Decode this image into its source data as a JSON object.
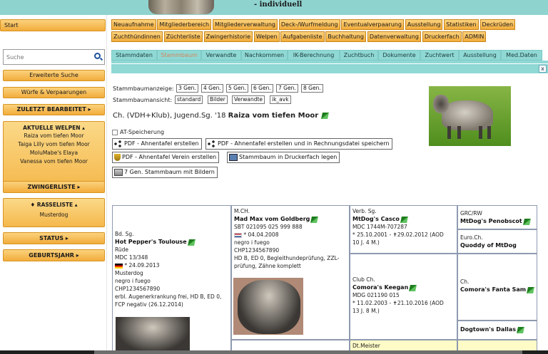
{
  "header": {
    "subtitle": "- individuell"
  },
  "sidebar": {
    "start": "Start",
    "search_placeholder": "Suche",
    "buttons": [
      "Erweiterte Suche",
      "Würfe & Verpaarungen",
      "ZULETZT BEARBEITET ▸"
    ],
    "current_welpen": {
      "title": "AKTUELLE WELPEN ▴",
      "items": [
        "Raiza vom tiefen Moor",
        "Taiga Lilly vom tiefen Moor",
        "MoluMabe's Elaya",
        "Vanessa vom tiefen Moor"
      ]
    },
    "zwingerliste": "ZWINGERLISTE ▸",
    "rasseliste": {
      "title": "♦ RASSELISTE ▴",
      "items": [
        "Musterdog"
      ]
    },
    "status": "STATUS ▸",
    "geburtsjahr": "GEBURTSJAHR ▸"
  },
  "menu_row1": [
    "Neuaufnahme",
    "Mitgliederbereich",
    "Mitgliederverwaltung",
    "Deck-/Wurfmeldung",
    "Eventualverpaarung",
    "Ausstellung",
    "Statistiken",
    "Deckrüden"
  ],
  "menu_row2": [
    "Zuchthündinnen",
    "Züchterliste",
    "Zwingerhistorie",
    "Welpen",
    "Aufgabenliste",
    "Buchhaltung",
    "Datenverwaltung",
    "Druckerfach",
    "ADMIN"
  ],
  "tabs": [
    "Stammdaten",
    "Stammbaum",
    "Verwandte",
    "Nachkommen",
    "IK-Berechnung",
    "Zuchtbuch",
    "Dokumente",
    "Zuchtwert",
    "Ausstellung",
    "Med.Daten"
  ],
  "close_label": "x",
  "stammbaum": {
    "anzeige_label": "Stammbaumanzeige:",
    "generations": [
      "3 Gen.",
      "4 Gen.",
      "5 Gen.",
      "6 Gen.",
      "7 Gen.",
      "8 Gen."
    ],
    "ansicht_label": "Stammbaumansicht:",
    "views": [
      "standard",
      "Bilder",
      "Verwandte",
      "ik_avk"
    ],
    "dog_prefix": "Ch. (VDH+Klub), Jugend.Sg. '18",
    "dog_name": "Raiza vom tiefen Moor",
    "at_speicherung": "AT-Speicherung",
    "actions": [
      "PDF - Ahnentafel erstellen",
      "PDF - Ahnentafel erstellen und in Rechnungsdatei speichern",
      "PDF - Ahnentafel Verein erstellen",
      "Stammbaum in Druckerfach legen",
      "7 Gen. Stammbaum mit Bildern"
    ]
  },
  "pedigree": {
    "father": {
      "title": "Bd. Sg.",
      "name": "Hot Pepper's Toulouse",
      "lines": [
        "Rüde",
        "MDC 13/348",
        "24.09.2013",
        "Musterdog",
        "negro i fuego",
        "CHP1234567890",
        "erbl. Augenerkrankung frei, HD B, ED 0,",
        "FCP negativ (26.12.2014)"
      ]
    },
    "ff": {
      "title": "M.CH.",
      "name": "Mad Max vom Goldberg",
      "lines": [
        "SBT 021095 025 999 888",
        "04.04.2008",
        "negro i fuego",
        "CHP1234567890",
        "HD B, ED 0, Begleithundeprüfung, ZZL-",
        "prüfung, Zähne komplett"
      ]
    },
    "fff": {
      "title": "Verb. Sg.",
      "name": "MtDog's Casco",
      "lines": [
        "MDC 1744M-707287",
        "* 25.10.2001 - ✝29.02.2012 (AOD",
        "10 J. 4 M.)"
      ]
    },
    "ffm": {
      "title": "Club Ch.",
      "name": "Comora's Keegan",
      "lines": [
        "MDG 021190 015",
        "* 11.02.2003 - ✝21.10.2016 (AOD",
        "13 J. 8 M.)"
      ]
    },
    "ffff": {
      "title": "GRC/RW",
      "name": "MtDog's Penobscot"
    },
    "fffm": {
      "title": "Euro.Ch.",
      "name": "Quoddy of MtDog"
    },
    "ffmf": {
      "title": "Ch.",
      "name": "Comora's Fanta Sam"
    },
    "ffmm": {
      "title": "",
      "name": "Dogtown's Dallas"
    },
    "next": {
      "title": "Dt.Meister"
    }
  }
}
